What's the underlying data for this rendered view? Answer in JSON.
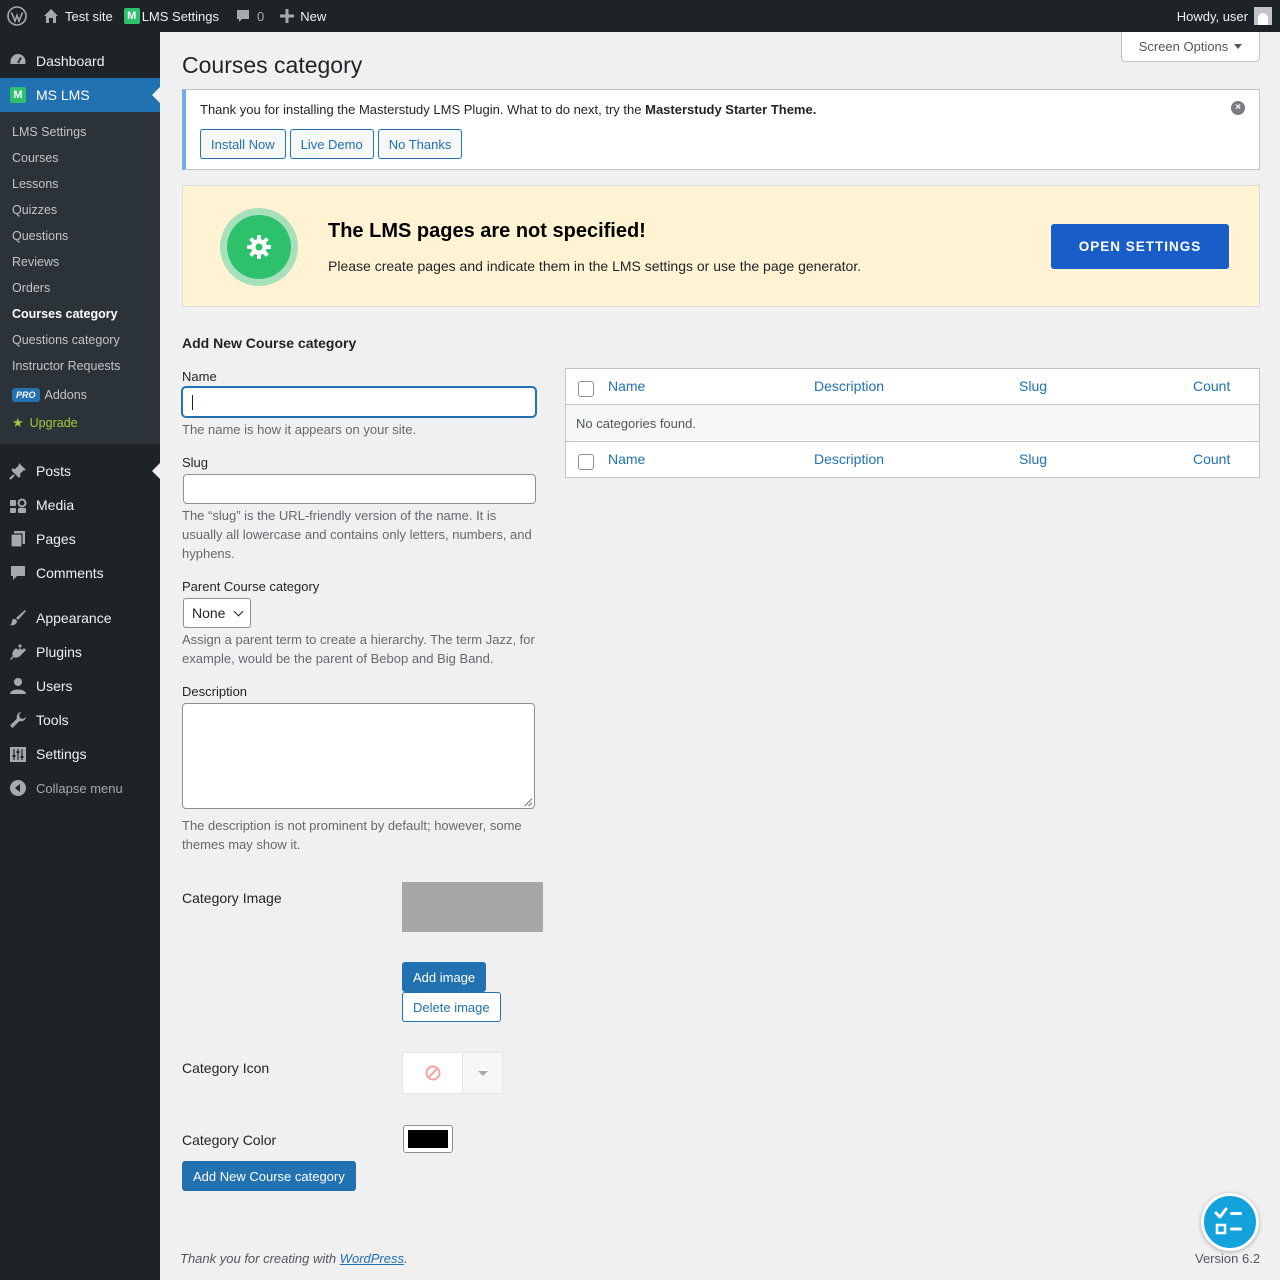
{
  "adminbar": {
    "site_name": "Test site",
    "lms_settings": "LMS Settings",
    "comments_count": "0",
    "new_label": "New",
    "howdy": "Howdy, user"
  },
  "sidebar": {
    "dashboard": "Dashboard",
    "ms_lms": "MS LMS",
    "sub": [
      "LMS Settings",
      "Courses",
      "Lessons",
      "Quizzes",
      "Questions",
      "Reviews",
      "Orders",
      "Courses category",
      "Questions category",
      "Instructor Requests"
    ],
    "pro_badge": "PRO",
    "addons": "Addons",
    "upgrade": "Upgrade",
    "menu": [
      "Posts",
      "Media",
      "Pages",
      "Comments",
      "Appearance",
      "Plugins",
      "Users",
      "Tools",
      "Settings"
    ],
    "collapse": "Collapse menu"
  },
  "page": {
    "title": "Courses category",
    "screen_options": "Screen Options"
  },
  "notice": {
    "text": "Thank you for installing the Masterstudy LMS Plugin. What to do next, try the ",
    "bold": "Masterstudy Starter Theme.",
    "install": "Install Now",
    "demo": "Live Demo",
    "no_thanks": "No Thanks"
  },
  "lms_notice": {
    "heading": "The LMS pages are not specified!",
    "text": "Please create pages and indicate them in the LMS settings or use the page generator.",
    "button": "OPEN SETTINGS"
  },
  "form": {
    "heading": "Add New Course category",
    "name_label": "Name",
    "name_value": "",
    "name_help": "The name is how it appears on your site.",
    "slug_label": "Slug",
    "slug_value": "",
    "slug_help": "The “slug” is the URL-friendly version of the name. It is usually all lowercase and contains only letters, numbers, and hyphens.",
    "parent_label": "Parent Course category",
    "parent_value": "None",
    "parent_help": "Assign a parent term to create a hierarchy. The term Jazz, for example, would be the parent of Bebop and Big Band.",
    "desc_label": "Description",
    "desc_value": "",
    "desc_help": "The description is not prominent by default; however, some themes may show it.",
    "image_label": "Category Image",
    "add_image": "Add image",
    "delete_image": "Delete image",
    "icon_label": "Category Icon",
    "color_label": "Category Color",
    "color_value": "#000000",
    "submit": "Add New Course category"
  },
  "table": {
    "columns": [
      "Name",
      "Description",
      "Slug",
      "Count"
    ],
    "empty": "No categories found."
  },
  "footer": {
    "thanks": "Thank you for creating with ",
    "wp_link": "WordPress",
    "period": ".",
    "version": "Version 6.2"
  },
  "colors": {
    "accent": "#2271b1",
    "lms_button": "#195ec8",
    "lms_green": "#2dc16b",
    "notice_bg": "#fff3d3",
    "fab": "#14a2dd"
  }
}
